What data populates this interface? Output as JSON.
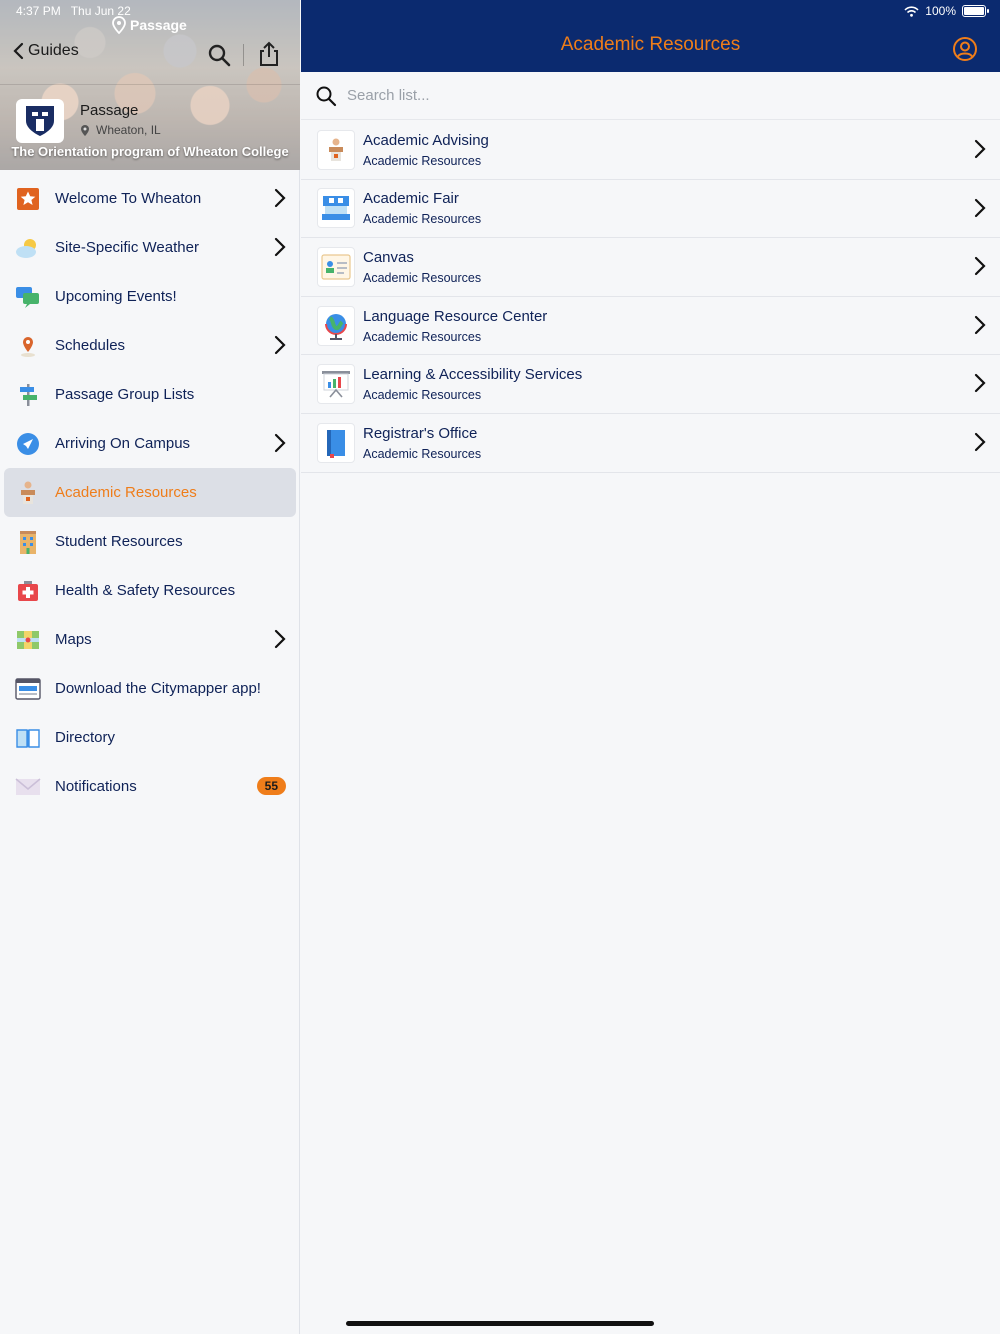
{
  "status": {
    "time": "4:37 PM",
    "date": "Thu Jun 22",
    "battery": "100%"
  },
  "hero": {
    "brand": "Passage",
    "back_label": "Guides",
    "org_name": "Passage",
    "org_location": "Wheaton, IL",
    "tagline": "The Orientation program of Wheaton College"
  },
  "sidebar": {
    "items": [
      {
        "label": "Welcome To Wheaton",
        "icon": "star-icon",
        "chevron": true
      },
      {
        "label": "Site-Specific Weather",
        "icon": "weather-icon",
        "chevron": true
      },
      {
        "label": "Upcoming Events!",
        "icon": "chat-icon",
        "chevron": false
      },
      {
        "label": "Schedules",
        "icon": "map-pin-icon",
        "chevron": true
      },
      {
        "label": "Passage Group Lists",
        "icon": "signpost-icon",
        "chevron": false
      },
      {
        "label": "Arriving On Campus",
        "icon": "navigation-icon",
        "chevron": true
      },
      {
        "label": "Academic Resources",
        "icon": "podium-icon",
        "chevron": false,
        "active": true
      },
      {
        "label": "Student Resources",
        "icon": "building-icon",
        "chevron": false
      },
      {
        "label": "Health & Safety Resources",
        "icon": "first-aid-icon",
        "chevron": false
      },
      {
        "label": "Maps",
        "icon": "map-icon",
        "chevron": true
      },
      {
        "label": "Download the Citymapper app!",
        "icon": "browser-icon",
        "chevron": false
      },
      {
        "label": "Directory",
        "icon": "book-icon",
        "chevron": false
      },
      {
        "label": "Notifications",
        "icon": "envelope-icon",
        "chevron": false,
        "badge": "55"
      }
    ]
  },
  "main": {
    "title": "Academic Resources",
    "search_placeholder": "Search list...",
    "list": [
      {
        "title": "Academic Advising",
        "subtitle": "Academic Resources",
        "icon": "podium-icon"
      },
      {
        "title": "Academic Fair",
        "subtitle": "Academic Resources",
        "icon": "booth-icon"
      },
      {
        "title": "Canvas",
        "subtitle": "Academic Resources",
        "icon": "id-card-icon"
      },
      {
        "title": "Language Resource Center",
        "subtitle": "Academic Resources",
        "icon": "globe-icon"
      },
      {
        "title": "Learning & Accessibility Services",
        "subtitle": "Academic Resources",
        "icon": "presentation-icon"
      },
      {
        "title": "Registrar's Office",
        "subtitle": "Academic Resources",
        "icon": "notebook-icon"
      }
    ]
  },
  "colors": {
    "accent": "#ef7d1a",
    "navy": "#0b2a6f",
    "text": "#0f2257"
  }
}
